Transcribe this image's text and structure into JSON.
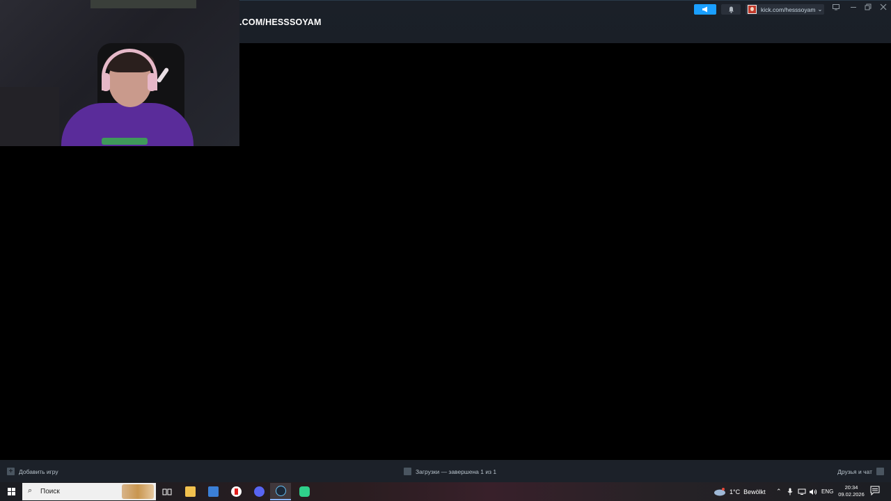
{
  "window": {
    "url_title": ".COM/HESSSOYAM",
    "account_label": "kick.com/hesssoyam",
    "account_caret": "⌄"
  },
  "icons": {
    "announce": "megaphone-icon",
    "bell": "bell-icon",
    "monitor": "monitor-icon",
    "minimize": "minimize-icon",
    "restore": "restore-icon",
    "close": "close-icon"
  },
  "bottom_bar": {
    "add_game": "Добавить игру",
    "downloads": "Загрузки — завершена 1 из 1",
    "friends_chat": "Друзья и чат"
  },
  "taskbar": {
    "search_placeholder": "Поиск",
    "apps": [
      "task-view",
      "file-explorer",
      "calculator",
      "yandex-browser",
      "discord",
      "steam",
      "app-green"
    ],
    "weather_temp": "1°C",
    "weather_desc": "Bewölkt",
    "language": "ENG",
    "time": "20:34",
    "date": "09.02.2026"
  },
  "colors": {
    "accent_blue": "#1a9fff",
    "header_bg": "#1b2028",
    "bottom_bar_bg": "#1c2129"
  }
}
